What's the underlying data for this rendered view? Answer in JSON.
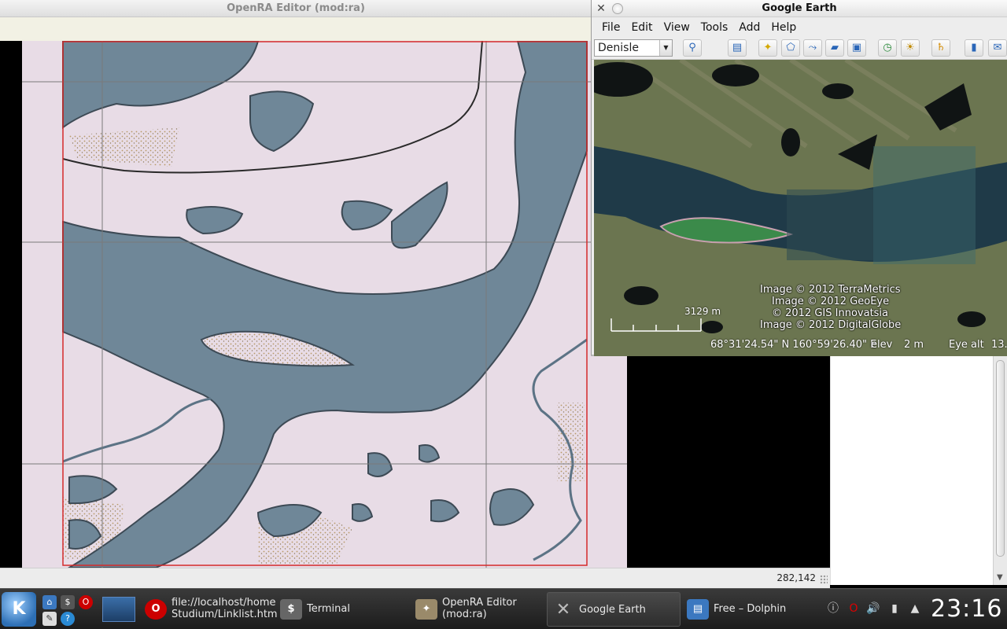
{
  "openra": {
    "title": "OpenRA Editor (mod:ra)",
    "status_coords": "282,142"
  },
  "google_earth": {
    "title": "Google Earth",
    "menu": [
      "File",
      "Edit",
      "View",
      "Tools",
      "Add",
      "Help"
    ],
    "search_combo_value": "Denisle",
    "credits": [
      "Image © 2012 TerraMetrics",
      "Image © 2012 GeoEye",
      "© 2012 GIS Innovatsia",
      "Image © 2012 DigitalGlobe"
    ],
    "scale_label": "3129 m",
    "coords": "68°31'24.54\" N  160°59'26.40\" E",
    "elev_label": "elev",
    "elev_value": "2 m",
    "eye_alt_label": "Eye alt",
    "eye_alt_value": "13."
  },
  "taskbar": {
    "tasks": [
      {
        "label": "file://localhost/home\nStudium/Linklist.htm",
        "icon": "opera-icon"
      },
      {
        "label": "Terminal",
        "icon": "terminal-icon"
      },
      {
        "label": "OpenRA Editor\n(mod:ra)",
        "icon": "openra-icon"
      },
      {
        "label": "Google Earth",
        "icon": "google-earth-icon"
      },
      {
        "label": "Free – Dolphin",
        "icon": "dolphin-icon"
      }
    ],
    "clock": "23:16"
  },
  "colors": {
    "water": "#6f8798",
    "snow": "#e8dce6",
    "map_border": "#d42a2a"
  }
}
